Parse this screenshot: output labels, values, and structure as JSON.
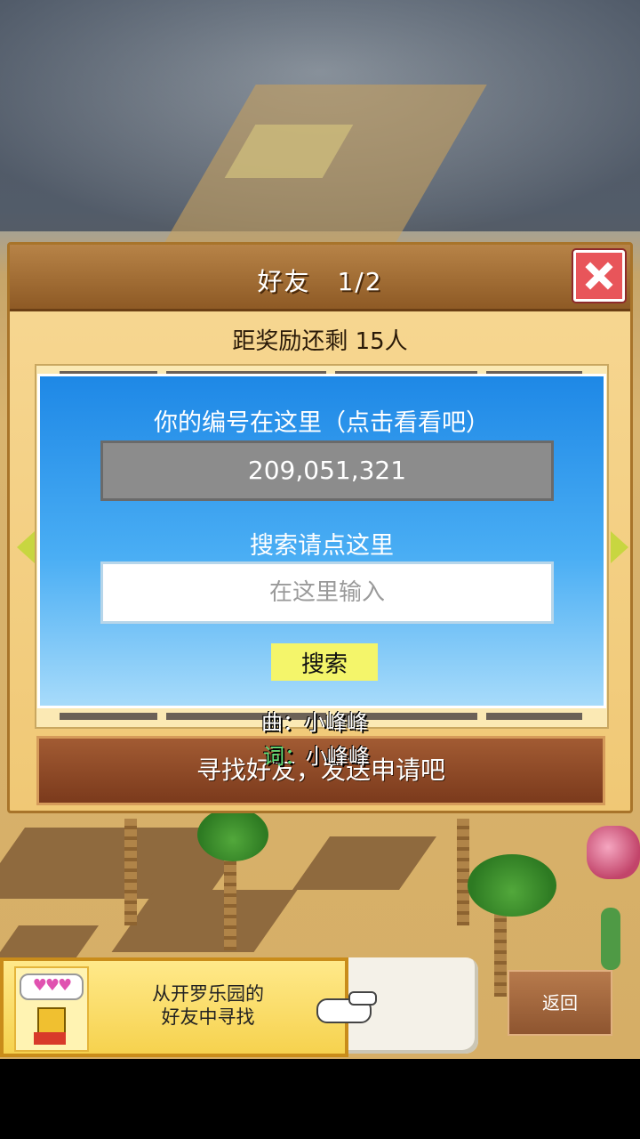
{
  "dialog": {
    "title": "好友　1/2",
    "reward_text": "距奖励还剩 15人",
    "id_label": "你的编号在这里（点击看看吧）",
    "id_value": "209,051,321",
    "search_label": "搜索请点这里",
    "search_placeholder": "在这里输入",
    "search_button": "搜索",
    "find_friends_button": "寻找好友，发送申请吧"
  },
  "credits": {
    "music_label": "曲：",
    "music_value": "小峰峰",
    "lyrics_label": "词：",
    "lyrics_value": "小峰峰"
  },
  "bottom_bar": {
    "kairo_line1": "从开罗乐园的",
    "kairo_line2": "好友中寻找",
    "bubble_hearts": "♥♥♥",
    "back_button": "返回"
  },
  "colors": {
    "panel_blue": "#1e88e6",
    "header_brown": "#8e5a25",
    "search_button_yellow": "#f4f56a",
    "close_red": "#e8555a"
  }
}
